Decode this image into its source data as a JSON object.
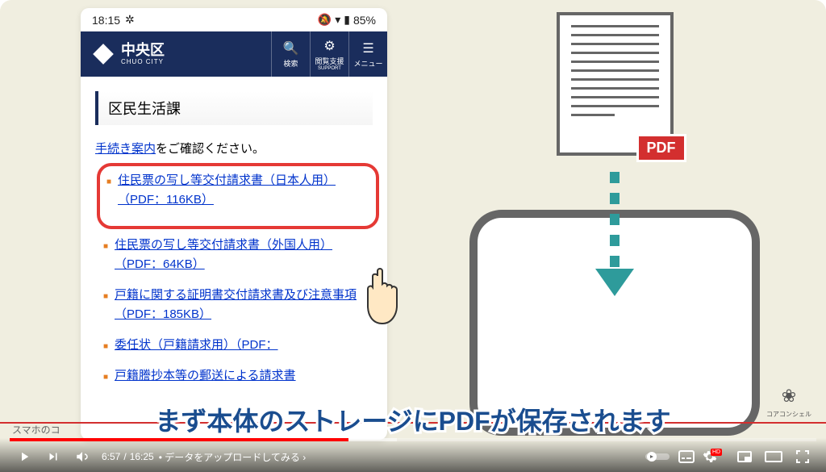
{
  "phone": {
    "status": {
      "time": "18:15",
      "battery_pct": "85%"
    },
    "header": {
      "city_jp": "中央区",
      "city_en": "CHUO CITY",
      "buttons": {
        "search": {
          "label": "検索"
        },
        "support": {
          "label": "閲覧支援",
          "sub": "SUPPORT"
        },
        "menu": {
          "label": "メニュー"
        }
      }
    },
    "section_title": "区民生活課",
    "instruction_prefix": "手続き案内",
    "instruction_suffix": "をご確認ください。",
    "documents": [
      {
        "label": "住民票の写し等交付請求書（日本人用）（PDF：116KB）",
        "highlighted": true
      },
      {
        "label": "住民票の写し等交付請求書（外国人用）（PDF：64KB）"
      },
      {
        "label": "戸籍に関する証明書交付請求書及び注意事項（PDF：185KB）"
      },
      {
        "label": "委任状（戸籍請求用）（PDF："
      },
      {
        "label": "戸籍謄抄本等の郵送による請求書"
      }
    ]
  },
  "pdf_badge": "PDF",
  "subtitle": "まず本体のストレージにPDFが保存されます",
  "watermarks": {
    "left": "スマホのコ",
    "right": "コアコンシェル"
  },
  "video_controls": {
    "current_time": "6:57",
    "total_time": "16:25",
    "chapter": "• データをアップロードしてみる",
    "hd": "HD"
  }
}
